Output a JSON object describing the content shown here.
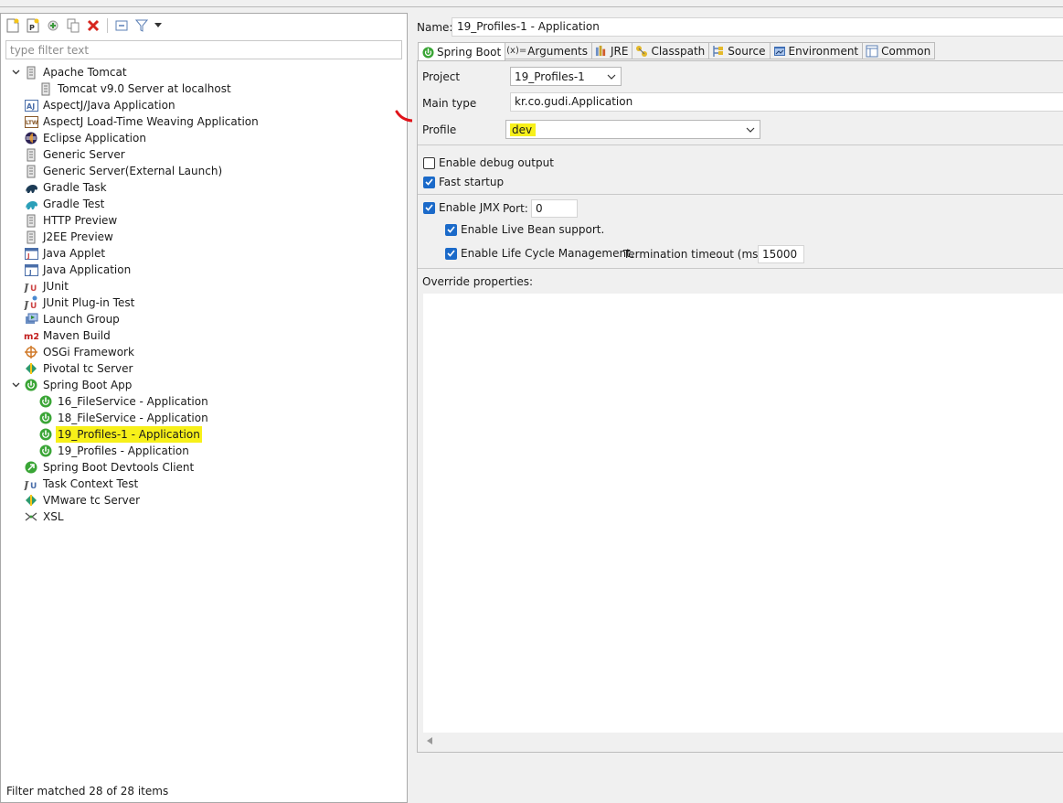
{
  "left": {
    "filter_placeholder": "type filter text",
    "tree": [
      {
        "label": "Apache Tomcat",
        "icon": "server-icon",
        "level": 0,
        "twisty": "expanded"
      },
      {
        "label": "Tomcat v9.0 Server at localhost",
        "icon": "server-icon",
        "level": 1
      },
      {
        "label": "AspectJ/Java Application",
        "icon": "aspectj-icon",
        "level": 0
      },
      {
        "label": "AspectJ Load-Time Weaving Application",
        "icon": "ltw-icon",
        "level": 0
      },
      {
        "label": "Eclipse Application",
        "icon": "eclipse-icon",
        "level": 0
      },
      {
        "label": "Generic Server",
        "icon": "server-icon",
        "level": 0
      },
      {
        "label": "Generic Server(External Launch)",
        "icon": "server-icon",
        "level": 0
      },
      {
        "label": "Gradle Task",
        "icon": "gradle-icon",
        "level": 0
      },
      {
        "label": "Gradle Test",
        "icon": "gradle-test-icon",
        "level": 0
      },
      {
        "label": "HTTP Preview",
        "icon": "server-icon",
        "level": 0
      },
      {
        "label": "J2EE Preview",
        "icon": "server-icon",
        "level": 0
      },
      {
        "label": "Java Applet",
        "icon": "applet-icon",
        "level": 0
      },
      {
        "label": "Java Application",
        "icon": "java-app-icon",
        "level": 0
      },
      {
        "label": "JUnit",
        "icon": "junit-icon",
        "level": 0
      },
      {
        "label": "JUnit Plug-in Test",
        "icon": "junit-plugin-icon",
        "level": 0
      },
      {
        "label": "Launch Group",
        "icon": "launch-group-icon",
        "level": 0
      },
      {
        "label": "Maven Build",
        "icon": "maven-icon",
        "level": 0
      },
      {
        "label": "OSGi Framework",
        "icon": "osgi-icon",
        "level": 0
      },
      {
        "label": "Pivotal tc Server",
        "icon": "pivotal-icon",
        "level": 0
      },
      {
        "label": "Spring Boot App",
        "icon": "spring-boot-icon",
        "level": 0,
        "twisty": "expanded"
      },
      {
        "label": "16_FileService - Application",
        "icon": "spring-boot-icon",
        "level": 1
      },
      {
        "label": "18_FileService - Application",
        "icon": "spring-boot-icon",
        "level": 1
      },
      {
        "label": "19_Profiles-1 - Application",
        "icon": "spring-boot-icon",
        "level": 1,
        "highlight": true
      },
      {
        "label": "19_Profiles - Application",
        "icon": "spring-boot-icon",
        "level": 1
      },
      {
        "label": "Spring Boot Devtools Client",
        "icon": "devtools-icon",
        "level": 0
      },
      {
        "label": "Task Context Test",
        "icon": "task-junit-icon",
        "level": 0
      },
      {
        "label": "VMware tc Server",
        "icon": "vmware-icon",
        "level": 0
      },
      {
        "label": "XSL",
        "icon": "xsl-icon",
        "level": 0
      }
    ],
    "status": "Filter matched 28 of 28 items"
  },
  "right": {
    "name_label": "Name:",
    "name_value": "19_Profiles-1 - Application",
    "tabs": [
      {
        "label": "Spring Boot",
        "icon": "spring-boot-icon",
        "active": true
      },
      {
        "label": "Arguments",
        "icon": "arguments-icon"
      },
      {
        "label": "JRE",
        "icon": "jre-icon"
      },
      {
        "label": "Classpath",
        "icon": "classpath-icon"
      },
      {
        "label": "Source",
        "icon": "source-icon"
      },
      {
        "label": "Environment",
        "icon": "environment-icon"
      },
      {
        "label": "Common",
        "icon": "common-icon"
      }
    ],
    "project_label": "Project",
    "project_value": "19_Profiles-1",
    "main_type_label": "Main type",
    "main_type_value": "kr.co.gudi.Application",
    "profile_label": "Profile",
    "profile_value": "dev",
    "debug_label": "Enable debug output",
    "debug_checked": false,
    "fast_startup_label": "Fast startup",
    "fast_startup_checked": true,
    "jmx_label": "Enable JMX",
    "jmx_checked": true,
    "port_label": "Port:",
    "port_value": "0",
    "live_bean_label": "Enable Live Bean support.",
    "live_bean_checked": true,
    "lifecycle_label": "Enable Life Cycle Management.",
    "lifecycle_checked": true,
    "timeout_label": "Termination timeout (ms):",
    "timeout_value": "15000",
    "override_label": "Override properties:"
  },
  "colors": {
    "highlight": "#f7f019",
    "annotation": "#e0131a",
    "spring_green": "#3aa536",
    "check_blue": "#1b6ac9"
  }
}
